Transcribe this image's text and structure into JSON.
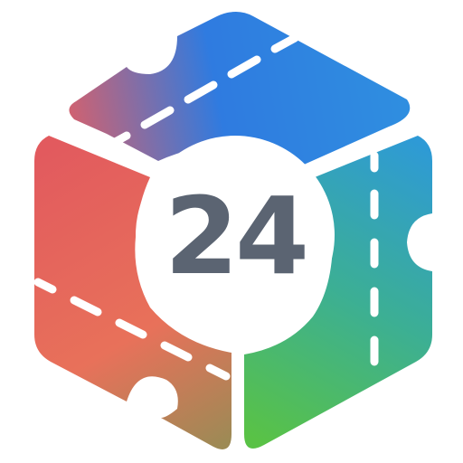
{
  "logo": {
    "number": "24",
    "colors": {
      "number": "#5b6472",
      "badge_fill": "#ffffff",
      "top_face_start": "#d9606a",
      "top_face_mid": "#2f7be0",
      "top_face_end": "#2f8fe0",
      "left_face_top": "#e25a5e",
      "left_face_bottom": "#9d8a55",
      "right_face_top": "#2e9ad6",
      "right_face_bottom": "#59c246",
      "dashes": "#ffffff"
    }
  }
}
